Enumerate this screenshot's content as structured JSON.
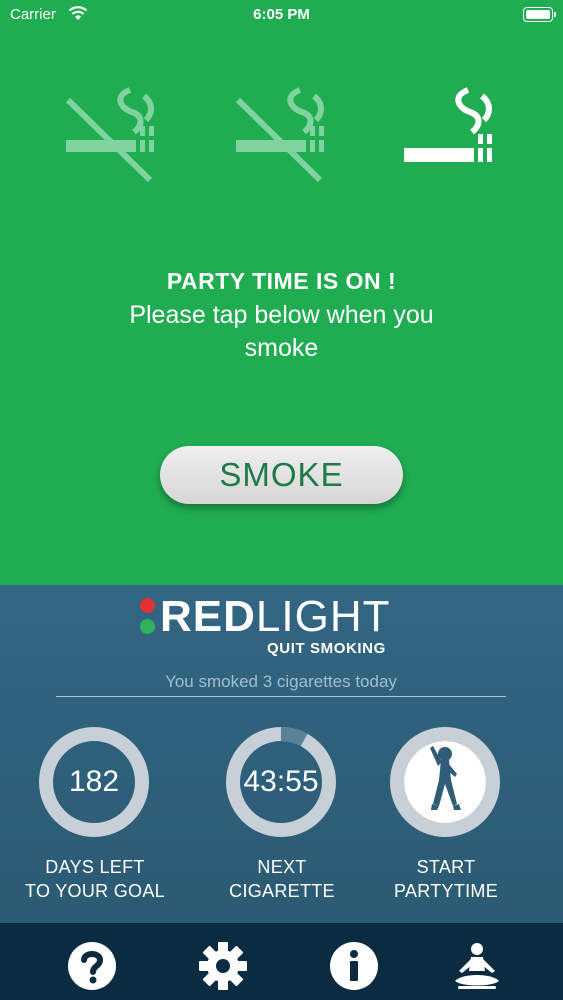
{
  "status_bar": {
    "carrier": "Carrier",
    "time": "6:05 PM"
  },
  "colors": {
    "top_bg": "#20ad52",
    "bottom_bg": "#336683",
    "tabbar_bg": "#0b2c40",
    "ring_track": "#c7d0d6",
    "button_text": "#1d7a46"
  },
  "cigarettes": [
    {
      "icon": "no-smoking-icon",
      "state": "not smoked"
    },
    {
      "icon": "no-smoking-icon",
      "state": "not smoked"
    },
    {
      "icon": "cigarette-icon",
      "state": "active"
    }
  ],
  "message": {
    "title": "PARTY TIME IS ON !",
    "body": "Please tap below when you smoke"
  },
  "smoke_button": "SMOKE",
  "logo": {
    "red": "RED",
    "light": "LIGHT",
    "subtitle": "QUIT SMOKING"
  },
  "smoked_today": "You smoked 3 cigarettes today",
  "stats": {
    "days_left": {
      "value": "182",
      "label_1": "DAYS LEFT",
      "label_2": "TO YOUR GOAL",
      "progress": 0
    },
    "next_cigarette": {
      "value": "43:55",
      "label_1": "NEXT",
      "label_2": "CIGARETTE",
      "progress": 0.92
    },
    "partytime": {
      "icon": "dancer-icon",
      "label_1": "START",
      "label_2": "PARTYTIME"
    }
  },
  "tabs": [
    {
      "icon": "help-icon"
    },
    {
      "icon": "gear-icon"
    },
    {
      "icon": "info-icon"
    },
    {
      "icon": "meditation-icon"
    }
  ]
}
